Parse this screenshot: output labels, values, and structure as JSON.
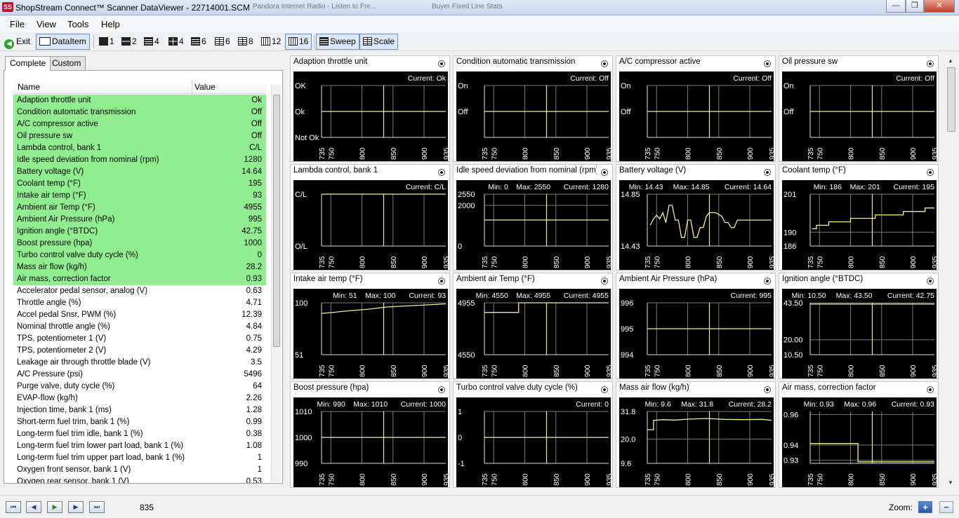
{
  "window": {
    "title": "ShopStream Connect™ Scanner DataViewer - 22714001.SCM",
    "app_icon": "SS",
    "background_tabs": [
      "Pandora Internet Radio - Listen to Fre...",
      "Buyer Fixed Line Stats"
    ],
    "controls": {
      "minimize": "—",
      "maximize": "❐",
      "close": "✕"
    }
  },
  "menu": [
    "File",
    "View",
    "Tools",
    "Help"
  ],
  "toolbar": {
    "exit": "Exit",
    "dataitem": "DataItem",
    "layouts": [
      "1",
      "2",
      "4",
      "4",
      "6",
      "6",
      "8",
      "12",
      "16"
    ],
    "sweep": "Sweep",
    "scale": "Scale"
  },
  "left_panel": {
    "tabs": [
      "Complete",
      "Custom"
    ],
    "columns": {
      "name": "Name",
      "value": "Value"
    },
    "rows": [
      {
        "name": "Adaption throttle unit",
        "value": "Ok",
        "hl": true
      },
      {
        "name": "Condition automatic transmission",
        "value": "Off",
        "hl": true
      },
      {
        "name": "A/C compressor active",
        "value": "Off",
        "hl": true
      },
      {
        "name": "Oil pressure sw",
        "value": "Off",
        "hl": true
      },
      {
        "name": "Lambda control, bank 1",
        "value": "C/L",
        "hl": true
      },
      {
        "name": "Idle speed deviation from nominal (rpm)",
        "value": "1280",
        "hl": true
      },
      {
        "name": "Battery voltage (V)",
        "value": "14.64",
        "hl": true
      },
      {
        "name": "Coolant temp (°F)",
        "value": "195",
        "hl": true
      },
      {
        "name": "Intake air temp (°F)",
        "value": "93",
        "hl": true
      },
      {
        "name": "Ambient air Temp (°F)",
        "value": "4955",
        "hl": true
      },
      {
        "name": "Ambient Air Pressure (hPa)",
        "value": "995",
        "hl": true
      },
      {
        "name": "Ignition angle (°BTDC)",
        "value": "42.75",
        "hl": true
      },
      {
        "name": "Boost pressure (hpa)",
        "value": "1000",
        "hl": true
      },
      {
        "name": "Turbo control valve duty cycle (%)",
        "value": "0",
        "hl": true
      },
      {
        "name": "Mass air flow (kg/h)",
        "value": "28.2",
        "hl": true
      },
      {
        "name": "Air mass, correction factor",
        "value": "0.93",
        "hl": true
      },
      {
        "name": "Accelerator pedal sensor, analog (V)",
        "value": "0.63",
        "hl": false
      },
      {
        "name": "Throttle angle (%)",
        "value": "4.71",
        "hl": false
      },
      {
        "name": "Accel pedal Snsr, PWM (%)",
        "value": "12.39",
        "hl": false
      },
      {
        "name": "Nominal throttle angle (%)",
        "value": "4.84",
        "hl": false
      },
      {
        "name": "TPS, potentiometer 1 (V)",
        "value": "0.75",
        "hl": false
      },
      {
        "name": "TPS, potentiometer 2 (V)",
        "value": "4.29",
        "hl": false
      },
      {
        "name": "Leakage air through throttle blade (V)",
        "value": "3.5",
        "hl": false
      },
      {
        "name": "A/C Pressure (psi)",
        "value": "5496",
        "hl": false
      },
      {
        "name": "Purge valve, duty cycle (%)",
        "value": "64",
        "hl": false
      },
      {
        "name": "EVAP-flow (kg/h)",
        "value": "2.26",
        "hl": false
      },
      {
        "name": "Injection time, bank 1 (ms)",
        "value": "1.28",
        "hl": false
      },
      {
        "name": "Short-term fuel trim, bank 1 (%)",
        "value": "0.99",
        "hl": false
      },
      {
        "name": "Long-term fuel trim idle, bank 1 (%)",
        "value": "0.38",
        "hl": false
      },
      {
        "name": "Long-term fuel trim lower part load, bank 1 (%)",
        "value": "1.08",
        "hl": false
      },
      {
        "name": "Long-term fuel trim upper part load, bank 1 (%)",
        "value": "1",
        "hl": false
      },
      {
        "name": "Oxygen front sensor, bank 1 (V)",
        "value": "1",
        "hl": false
      },
      {
        "name": "Oxygen rear sensor, bank 1 (V)",
        "value": "0.53",
        "hl": false
      }
    ]
  },
  "graphs": {
    "x_ticks": [
      "735",
      "750",
      "800",
      "850",
      "900",
      "935"
    ],
    "x_range": [
      735,
      935
    ],
    "cursor": 835,
    "panels": [
      {
        "title": "Adaption throttle unit",
        "stats": {
          "current": "Current: Ok"
        },
        "y_ticks": [
          {
            "v": 2,
            "l": "OK"
          },
          {
            "v": 1,
            "l": "Ok"
          },
          {
            "v": 0,
            "l": "Not Ok"
          }
        ],
        "y_range": [
          0,
          2
        ],
        "series": [
          [
            735,
            1
          ],
          [
            935,
            1
          ]
        ]
      },
      {
        "title": "Condition automatic transmission",
        "stats": {
          "current": "Current: Off"
        },
        "y_ticks": [
          {
            "v": 1,
            "l": "On"
          },
          {
            "v": 0,
            "l": "Off"
          }
        ],
        "y_range": [
          -1,
          1
        ],
        "series": [
          [
            735,
            0
          ],
          [
            935,
            0
          ]
        ]
      },
      {
        "title": "A/C compressor active",
        "stats": {
          "current": "Current: Off"
        },
        "y_ticks": [
          {
            "v": 1,
            "l": "On"
          },
          {
            "v": 0,
            "l": "Off"
          }
        ],
        "y_range": [
          -1,
          1
        ],
        "series": [
          [
            735,
            0
          ],
          [
            935,
            0
          ]
        ]
      },
      {
        "title": "Oil pressure sw",
        "stats": {
          "current": "Current: Off"
        },
        "y_ticks": [
          {
            "v": 1,
            "l": "On"
          },
          {
            "v": 0,
            "l": "Off"
          }
        ],
        "y_range": [
          -1,
          1
        ],
        "series": [
          [
            735,
            0
          ],
          [
            935,
            0
          ]
        ]
      },
      {
        "title": "Lambda control, bank 1",
        "stats": {
          "current": "Current: C/L"
        },
        "y_ticks": [
          {
            "v": 1,
            "l": "C/L"
          },
          {
            "v": 0,
            "l": "O/L"
          }
        ],
        "y_range": [
          0,
          1
        ],
        "series": [
          [
            735,
            1
          ],
          [
            935,
            1
          ]
        ]
      },
      {
        "title": "Idle speed deviation from nominal (rpm)",
        "stats": {
          "min": "Min: 0",
          "max": "Max: 2550",
          "current": "Current: 1280"
        },
        "y_ticks": [
          {
            "v": 2550,
            "l": "2550"
          },
          {
            "v": 2000,
            "l": "2000"
          },
          {
            "v": 0,
            "l": "0"
          }
        ],
        "y_range": [
          0,
          2550
        ],
        "series": [
          [
            735,
            1280
          ],
          [
            935,
            1280
          ]
        ]
      },
      {
        "title": "Battery voltage (V)",
        "stats": {
          "min": "Min: 14.43",
          "max": "Max: 14.85",
          "current": "Current: 14.64"
        },
        "y_ticks": [
          {
            "v": 14.85,
            "l": "14.85"
          },
          {
            "v": 14.43,
            "l": "14.43"
          }
        ],
        "y_range": [
          14.43,
          14.85
        ],
        "series": [
          [
            740,
            14.6
          ],
          [
            745,
            14.65
          ],
          [
            750,
            14.68
          ],
          [
            755,
            14.65
          ],
          [
            760,
            14.7
          ],
          [
            765,
            14.62
          ],
          [
            770,
            14.76
          ],
          [
            775,
            14.76
          ],
          [
            780,
            14.64
          ],
          [
            785,
            14.64
          ],
          [
            790,
            14.5
          ],
          [
            795,
            14.5
          ],
          [
            800,
            14.64
          ],
          [
            805,
            14.64
          ],
          [
            810,
            14.5
          ],
          [
            815,
            14.5
          ],
          [
            820,
            14.58
          ],
          [
            825,
            14.58
          ],
          [
            830,
            14.67
          ],
          [
            835,
            14.7
          ],
          [
            845,
            14.7
          ],
          [
            855,
            14.67
          ],
          [
            860,
            14.62
          ],
          [
            865,
            14.62
          ],
          [
            870,
            14.58
          ],
          [
            875,
            14.58
          ],
          [
            880,
            14.64
          ],
          [
            935,
            14.64
          ]
        ]
      },
      {
        "title": "Coolant temp (°F)",
        "stats": {
          "min": "Min: 186",
          "max": "Max: 201",
          "current": "Current: 195"
        },
        "y_ticks": [
          {
            "v": 201,
            "l": "201"
          },
          {
            "v": 190,
            "l": "190"
          },
          {
            "v": 186,
            "l": "186"
          }
        ],
        "y_range": [
          186,
          201
        ],
        "series": [
          [
            738,
            191
          ],
          [
            745,
            191
          ],
          [
            745,
            192
          ],
          [
            765,
            192
          ],
          [
            765,
            193
          ],
          [
            800,
            193
          ],
          [
            800,
            194
          ],
          [
            840,
            194
          ],
          [
            840,
            195
          ],
          [
            885,
            195
          ],
          [
            885,
            196
          ],
          [
            920,
            196
          ],
          [
            920,
            197
          ],
          [
            935,
            197
          ]
        ]
      },
      {
        "title": "Intake air temp (°F)",
        "stats": {
          "min": "Min: 51",
          "max": "Max: 100",
          "current": "Current: 93"
        },
        "y_ticks": [
          {
            "v": 100,
            "l": "100"
          },
          {
            "v": 51,
            "l": "51"
          }
        ],
        "y_range": [
          51,
          100
        ],
        "series": [
          [
            735,
            90
          ],
          [
            755,
            91
          ],
          [
            770,
            92
          ],
          [
            790,
            93
          ],
          [
            810,
            94
          ],
          [
            840,
            96
          ],
          [
            870,
            97
          ],
          [
            905,
            98
          ],
          [
            935,
            99
          ]
        ]
      },
      {
        "title": "Ambient air Temp (°F)",
        "stats": {
          "min": "Min: 4550",
          "max": "Max: 4955",
          "current": "Current: 4955"
        },
        "y_ticks": [
          {
            "v": 4955,
            "l": "4955"
          },
          {
            "v": 4550,
            "l": "4550"
          }
        ],
        "y_range": [
          4550,
          4955
        ],
        "series": [
          [
            735,
            4880
          ],
          [
            790,
            4880
          ],
          [
            790,
            4955
          ],
          [
            935,
            4955
          ]
        ]
      },
      {
        "title": "Ambient Air Pressure (hPa)",
        "stats": {
          "current": "Current: 995"
        },
        "y_ticks": [
          {
            "v": 996,
            "l": "996"
          },
          {
            "v": 995,
            "l": "995"
          },
          {
            "v": 994,
            "l": "994"
          }
        ],
        "y_range": [
          994,
          996
        ],
        "series": [
          [
            735,
            995
          ],
          [
            935,
            995
          ]
        ]
      },
      {
        "title": "Ignition angle (°BTDC)",
        "stats": {
          "min": "Min: 10.50",
          "max": "Max: 43.50",
          "current": "Current: 42.75"
        },
        "y_ticks": [
          {
            "v": 43.5,
            "l": "43.50"
          },
          {
            "v": 20,
            "l": "20.00"
          },
          {
            "v": 10.5,
            "l": "10.50"
          }
        ],
        "y_range": [
          10.5,
          43.5
        ],
        "series": [
          [
            735,
            42.75
          ],
          [
            935,
            42.75
          ]
        ]
      },
      {
        "title": "Boost pressure (hpa)",
        "stats": {
          "min": "Min: 990",
          "max": "Max: 1010",
          "current": "Current: 1000"
        },
        "y_ticks": [
          {
            "v": 1010,
            "l": "1010"
          },
          {
            "v": 1000,
            "l": "1000"
          },
          {
            "v": 990,
            "l": "990"
          }
        ],
        "y_range": [
          990,
          1010
        ],
        "series": [
          [
            735,
            1000
          ],
          [
            935,
            1000
          ]
        ]
      },
      {
        "title": "Turbo control valve duty cycle (%)",
        "stats": {
          "current": "Current: 0"
        },
        "y_ticks": [
          {
            "v": 1,
            "l": "1"
          },
          {
            "v": 0,
            "l": "0"
          },
          {
            "v": -1,
            "l": "-1"
          }
        ],
        "y_range": [
          -1,
          1
        ],
        "series": [
          [
            735,
            0
          ],
          [
            935,
            0
          ]
        ]
      },
      {
        "title": "Mass air flow (kg/h)",
        "stats": {
          "min": "Min: 9.6",
          "max": "Max: 31.8",
          "current": "Current: 28.2"
        },
        "y_ticks": [
          {
            "v": 31.8,
            "l": "31.8"
          },
          {
            "v": 20,
            "l": "20.0"
          },
          {
            "v": 9.6,
            "l": "9.6"
          }
        ],
        "y_range": [
          9.6,
          31.8
        ],
        "series": [
          [
            735,
            24
          ],
          [
            745,
            24
          ],
          [
            745,
            28
          ],
          [
            760,
            28.3
          ],
          [
            780,
            28.1
          ],
          [
            800,
            28.5
          ],
          [
            830,
            28.8
          ],
          [
            860,
            28.4
          ],
          [
            890,
            28.3
          ],
          [
            920,
            28.4
          ],
          [
            935,
            28.0
          ]
        ]
      },
      {
        "title": "Air mass, correction factor",
        "stats": {
          "min": "Min: 0.93",
          "max": "Max: 0.96",
          "current": "Current: 0.93"
        },
        "y_ticks": [
          {
            "v": 0.96,
            "l": "0.96"
          },
          {
            "v": 0.94,
            "l": "0.94"
          },
          {
            "v": 0.93,
            "l": "0.93"
          }
        ],
        "y_range": [
          0.928,
          0.962
        ],
        "series": [
          [
            735,
            0.941
          ],
          [
            812,
            0.941
          ],
          [
            812,
            0.929
          ],
          [
            935,
            0.929
          ]
        ]
      }
    ]
  },
  "bottom": {
    "nav": [
      "⏮",
      "◀",
      "▶",
      "▶",
      "⏭"
    ],
    "frame": "835",
    "zoom_label": "Zoom:",
    "zoom_in": "+",
    "zoom_out": "−"
  }
}
